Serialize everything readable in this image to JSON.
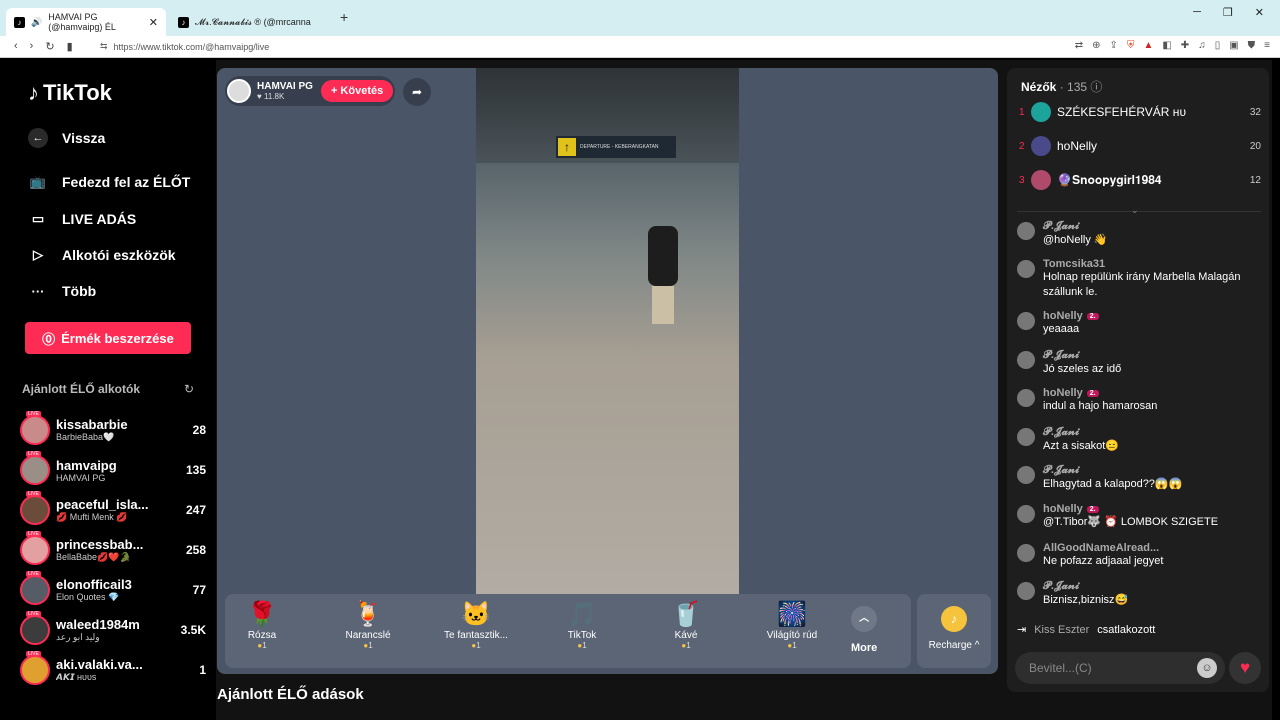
{
  "browser": {
    "tabs": [
      {
        "label": "HAMVAI PG (@hamvaipg) ÉL"
      },
      {
        "label": "𝓜𝓻.𝓒𝓪𝓷𝓷𝓪𝓫𝓲𝓼 ® (@mrcanna"
      }
    ],
    "new_tab": "+",
    "url": "https://www.tiktok.com/@hamvaipg/live"
  },
  "sidebar": {
    "logo": "TikTok",
    "menu": [
      {
        "label": "Vissza"
      },
      {
        "label": "Fedezd fel az ÉLŐT"
      },
      {
        "label": "LIVE ADÁS"
      },
      {
        "label": "Alkotói eszközök"
      },
      {
        "label": "Több"
      }
    ],
    "coins_button": "Érmék beszerzése",
    "recommended_title": "Ajánlott ÉLŐ alkotók",
    "creators": [
      {
        "name": "kissabarbie",
        "sub": "BarbieBaba🤍",
        "count": "28",
        "color": "#c98a8a"
      },
      {
        "name": "hamvaipg",
        "sub": "HAMVAI PG",
        "count": "135",
        "color": "#9a8f86"
      },
      {
        "name": "peaceful_isla...",
        "sub": "💋 Mufti Menk 💋",
        "count": "247",
        "color": "#6b4b3a"
      },
      {
        "name": "princessbab...",
        "sub": "BellaBabe💋❤️🐊",
        "count": "258",
        "color": "#e2a0a0"
      },
      {
        "name": "elonofficail3",
        "sub": "Elon Quotes 💎",
        "count": "77",
        "color": "#555c66"
      },
      {
        "name": "waleed1984m",
        "sub": "وليد ابو رعد",
        "count": "3.5K",
        "color": "#3c3c3c"
      },
      {
        "name": "aki.valaki.va...",
        "sub": "𝘼𝙆𝙄 ʜᴜᴜs",
        "count": "1",
        "color": "#e0a030"
      }
    ],
    "live_tag": "LIVE"
  },
  "player": {
    "host_name": "HAMVAI PG",
    "host_likes": "♥ 11.8K",
    "follow": "+ Követés",
    "sign_text": "DEPARTURE - KEBERANGKATAN",
    "gifts": [
      {
        "name": "Rózsa",
        "price": "1",
        "icon": "🌹"
      },
      {
        "name": "Narancslé",
        "price": "1",
        "icon": "🍹"
      },
      {
        "name": "Te fantasztik...",
        "price": "1",
        "icon": "🐱"
      },
      {
        "name": "TikTok",
        "price": "1",
        "icon": "🎵"
      },
      {
        "name": "Kávé",
        "price": "1",
        "icon": "🥤"
      },
      {
        "name": "Világító rúd",
        "price": "1",
        "icon": "🎆"
      }
    ],
    "more": "More",
    "recharge": "Recharge ^"
  },
  "recommended_live": "Ajánlott ÉLŐ adások",
  "chat": {
    "viewers_label": "Nézők",
    "viewers_count": "· 135",
    "top_viewers": [
      {
        "rank": "1",
        "name": "SZÉKESFEHÉRVÁR ʜᴜ",
        "coins": "32",
        "color": "#1ba39c"
      },
      {
        "rank": "2",
        "name": "hoNelly",
        "coins": "20",
        "color": "#4a4a8a"
      },
      {
        "rank": "3",
        "name": "🔮𝐒𝐧𝐨𝐨𝐩𝐲𝐠𝐢𝐫𝐥𝟏𝟗𝟖𝟒",
        "coins": "12",
        "color": "#b04a6a"
      }
    ],
    "messages": [
      {
        "name": "𝓟.𝓙𝓪𝓷𝓲",
        "text": "@hoNelly 👋",
        "badge": ""
      },
      {
        "name": "Tomcsika31",
        "text": "Holnap repülünk irány Marbella Malagán szállunk le.",
        "badge": ""
      },
      {
        "name": "hoNelly",
        "text": "yeaaaa",
        "badge": "2."
      },
      {
        "name": "𝓟.𝓙𝓪𝓷𝓲",
        "text": "Jó szeles az idő",
        "badge": ""
      },
      {
        "name": "hoNelly",
        "text": "indul a hajo hamarosan",
        "badge": "2."
      },
      {
        "name": "𝓟.𝓙𝓪𝓷𝓲",
        "text": "Azt a sisakot😑",
        "badge": ""
      },
      {
        "name": "𝓟.𝓙𝓪𝓷𝓲",
        "text": "Elhagytad a kalapod??😱😱",
        "badge": ""
      },
      {
        "name": "hoNelly",
        "text": "@T.Tibor🐺 ⏰ LOMBOK SZIGETE",
        "badge": "2."
      },
      {
        "name": "AllGoodNameAlread...",
        "text": "Ne pofazz adjaaal jegyet",
        "badge": ""
      },
      {
        "name": "𝓟.𝓙𝓪𝓷𝓲",
        "text": "Biznisz,biznisz😅",
        "badge": ""
      }
    ],
    "joined_name": "Kiss Eszter",
    "joined_text": "csatlakozott",
    "input_placeholder": "Bevitel...(C)"
  }
}
